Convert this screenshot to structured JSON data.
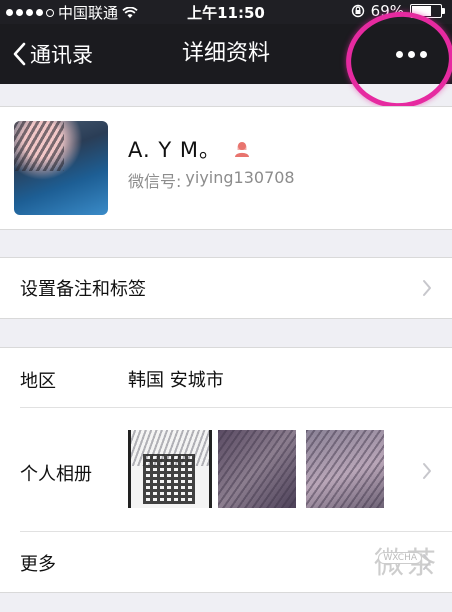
{
  "status_bar": {
    "carrier": "中国联通",
    "time": "上午11:50",
    "battery": "69%",
    "battery_level": 0.69
  },
  "nav": {
    "back_label": "通讯录",
    "title": "详细资料",
    "more_icon": "more-dots-icon"
  },
  "profile": {
    "name": "A.      Y M。",
    "wechat_id_label": "微信号:",
    "wechat_id": "yiying130708",
    "gender_icon": "female-user-icon"
  },
  "remark": {
    "label": "设置备注和标签"
  },
  "region": {
    "label": "地区",
    "value": "韩国 安城市"
  },
  "album": {
    "label": "个人相册"
  },
  "more_row": {
    "label": "更多"
  },
  "watermark": {
    "text": "微茶",
    "sub": "WXCHA"
  },
  "colors": {
    "nav_bg": "#1b1b1f",
    "page_bg": "#efeff4",
    "annotation": "#e62aa0",
    "female_icon": "#e8746e"
  }
}
